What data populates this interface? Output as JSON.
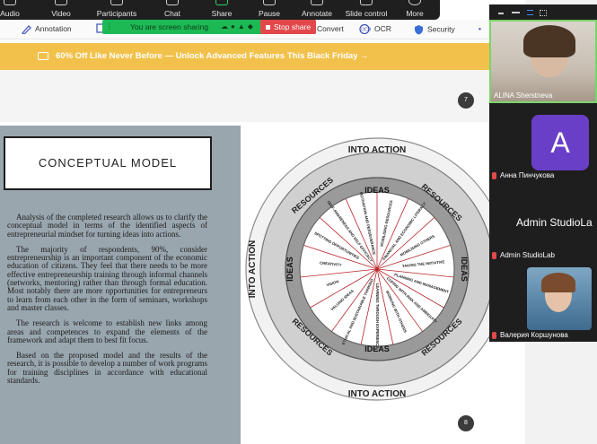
{
  "zoom_toolbar": {
    "items": [
      {
        "label": "Audio"
      },
      {
        "label": "Video"
      },
      {
        "label": "Participants"
      },
      {
        "label": "Chat"
      },
      {
        "label": "Share"
      },
      {
        "label": "Pause"
      },
      {
        "label": "Annotate"
      },
      {
        "label": "Slide control"
      },
      {
        "label": "More"
      }
    ]
  },
  "pdf_toolbar": {
    "annotation": "Annotation",
    "convert": "Convert",
    "ocr": "OCR",
    "security": "Security"
  },
  "share_bar": {
    "status": "You are screen sharing",
    "stop": "Stop share"
  },
  "promo": {
    "text": "60% Off Like Never Before — Unlock Advanced Features This Black Friday →"
  },
  "pages": {
    "prev_page_number": "7",
    "current_page_number": "8"
  },
  "slide": {
    "title": "CONCEPTUAL MODEL",
    "paragraphs": [
      "Analysis of the completed research allows us to clarify the conceptual model in terms of the identified aspects of entrepreneurial mindset for turning ideas into actions.",
      "The majority of respondents, 90%, consider entrepreneurship is an important component of the economic education of citizens. They feel that there needs to be more effective entrepreneurship training through informal channels (networks, mentoring) rather than through formal education. Most notably there are more opportunities for entrepreneurs to learn from each other in the form of seminars, workshops and master classes.",
      "The research is welcome to establish new links among areas and competences to expand the elements of the framework and adapt them to best fit focus.",
      "Based on the proposed model and the results of the research, it is possible to develop a number of work programs for training disciplines in accordance with educational standards."
    ]
  },
  "diagram": {
    "outer_top": "INTO ACTION",
    "outer_bottom": "INTO ACTION",
    "outer_left": "INTO ACTION",
    "resources_tl": "RESOURCES",
    "resources_tr": "RESOURCES",
    "resources_bl": "RESOURCES",
    "resources_br": "RESOURCES",
    "ideas_top": "IDEAS",
    "ideas_bottom": "IDEAS",
    "ideas_left": "IDEAS",
    "ideas_right": "IDEAS",
    "segments": [
      "MOBILISING RESOURCES",
      "FINANCIAL AND ECONOMIC LITERACY",
      "MOBILISING OTHERS",
      "TAKING THE INITIATIVE",
      "PLANNING AND MANAGEMENT",
      "COPING WITH RISK AND AMBIGUITY",
      "WORKING WITH OTHERS",
      "LEARNING THROUGH EXPERIENCE",
      "ETHICAL AND SUSTAINABLE THINKING",
      "VALUING IDEAS",
      "VISION",
      "CREATIVITY",
      "SPOTTING OPPORTUNITIES",
      "SELF-AWARENESS AND SELF-EFFICACY",
      "MOTIVATION AND PERSEVERANCE"
    ]
  },
  "participants": [
    {
      "name": "ALINA Sherstneva"
    },
    {
      "name": "Анна Пинчукова",
      "initial": "A"
    },
    {
      "name": "Admin StudioLab",
      "display": "Admin StudioLa"
    },
    {
      "name": "Валерия Коршунова"
    }
  ]
}
